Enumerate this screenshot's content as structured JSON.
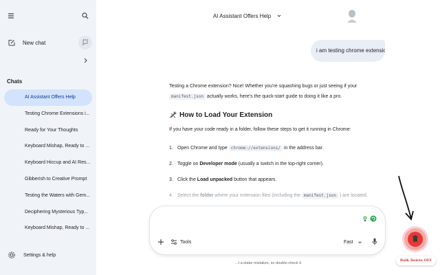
{
  "sidebar": {
    "new_chat_label": "New chat",
    "chats_heading": "Chats",
    "chats": [
      {
        "label": "AI Assistant Offers Help",
        "active": true
      },
      {
        "label": "Testing Chrome Extensions i...",
        "active": false
      },
      {
        "label": "Ready for Your Thoughts",
        "active": false
      },
      {
        "label": "Keyboard Mishap, Ready to ...",
        "active": false
      },
      {
        "label": "Keyboard Hiccup and AI Res...",
        "active": false
      },
      {
        "label": "Gibberish to Creative Prompt",
        "active": false
      },
      {
        "label": "Testing the Waters with Gem...",
        "active": false
      },
      {
        "label": "Deciphering Mysterious Typ...",
        "active": false
      },
      {
        "label": "Keyboard Mishap, Ready to ...",
        "active": false
      }
    ],
    "settings_label": "Settings & help"
  },
  "header": {
    "title": "AI Assistant Offers Help"
  },
  "conversation": {
    "user_message": "i am testing chrome extensio",
    "response": {
      "intro_before": "Testing a Chrome extension? Nice! Whether you're squashing bugs or just seeing if your",
      "intro_code": "manifest.json",
      "intro_after": "actually works, here's the quick-start guide to doing it like a pro.",
      "heading_emoji": "🛠",
      "heading": "How to Load Your Extension",
      "para": "If you have your code ready in a folder, follow these steps to get it running in Chrome:",
      "steps": [
        {
          "num": "1.",
          "before": "Open Chrome and type",
          "code": "chrome://extensions/",
          "after": "in the address bar."
        },
        {
          "num": "2.",
          "before": "Toggle on",
          "bold": "Developer mode",
          "after": "(usually a switch in the top-right corner)."
        },
        {
          "num": "3.",
          "before": "Click the",
          "bold": "Load unpacked",
          "after": "button that appears."
        },
        {
          "num": "4.",
          "before": "Select the",
          "bold": "folder",
          "mid": "where your extension files (including the",
          "code": "manifest.json",
          "after": ") are located."
        }
      ]
    }
  },
  "composer": {
    "placeholder": "",
    "tools_label": "Tools",
    "model_label": "Fast"
  },
  "disclaimer": "...t a:stake mistakes, so double-check it",
  "extension": {
    "bulk_delete_label": "Bulk Delete OFF",
    "colors": {
      "button": "#e53935",
      "halo": "#f4a7a7",
      "label": "#d32f2f"
    }
  },
  "colors": {
    "sidebar_bg": "#f0f4f9",
    "active_chat_bg": "#d3e3fd",
    "user_bubble_bg": "#e9eef6"
  },
  "icons": [
    "menu-icon",
    "search-icon",
    "edit-icon",
    "temporary-chat-icon",
    "chevron-right-icon",
    "gear-icon",
    "chevron-down-icon",
    "hammer-wrench-icon",
    "plus-icon",
    "tools-icon",
    "mic-icon",
    "trash-icon",
    "arrow-annotation"
  ]
}
